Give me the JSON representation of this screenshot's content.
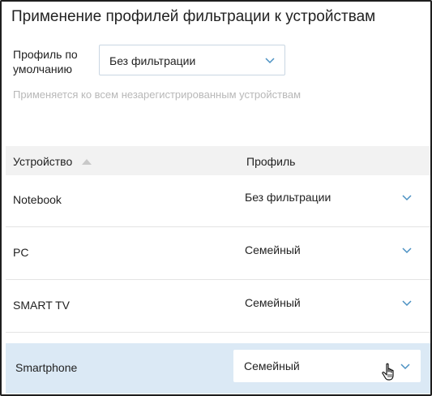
{
  "title": "Применение профилей фильтрации к устройствам",
  "default_profile": {
    "label": "Профиль по умолчанию",
    "value": "Без фильтрации",
    "hint": "Применяется ко всем незарегистрированным устройствам"
  },
  "table": {
    "columns": {
      "device": "Устройство",
      "profile": "Профиль"
    },
    "rows": [
      {
        "device": "Notebook",
        "profile": "Без фильтрации"
      },
      {
        "device": "PC",
        "profile": "Семейный"
      },
      {
        "device": "SMART TV",
        "profile": "Семейный"
      },
      {
        "device": "Smartphone",
        "profile": "Семейный"
      }
    ]
  },
  "colors": {
    "accent": "#4a90c2",
    "selected_row": "#dbe9f5",
    "header_bg": "#f2f2f2",
    "hint_text": "#b8b8b8"
  },
  "icons": {
    "dropdown": "chevron-down-icon",
    "sort": "sort-ascending-icon",
    "cursor": "hand-pointer-icon"
  }
}
